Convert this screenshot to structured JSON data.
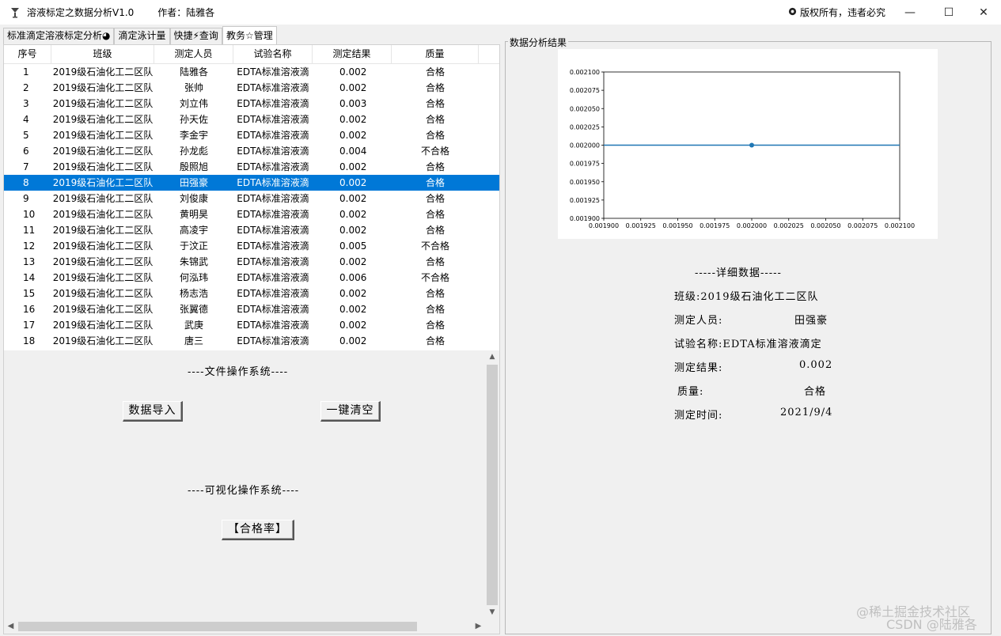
{
  "window": {
    "title": "溶液标定之数据分析V1.0",
    "author": "作者：陆雅各",
    "copyright": "版权所有，违者必究",
    "minimize": "—",
    "maximize": "☐",
    "close": "✕"
  },
  "tabs": [
    {
      "label": "标准滴定溶液标定分析◕"
    },
    {
      "label": "滴定泳计量"
    },
    {
      "label": "快捷⚡查询"
    },
    {
      "label": "教务☆管理"
    }
  ],
  "table": {
    "headers": [
      "序号",
      "班级",
      "测定人员",
      "试验名称",
      "测定结果",
      "质量"
    ],
    "rows": [
      [
        "1",
        "2019级石油化工二区队",
        "陆雅各",
        "EDTA标准溶液滴",
        "0.002",
        "合格"
      ],
      [
        "2",
        "2019级石油化工二区队",
        "张帅",
        "EDTA标准溶液滴",
        "0.002",
        "合格"
      ],
      [
        "3",
        "2019级石油化工二区队",
        "刘立伟",
        "EDTA标准溶液滴",
        "0.003",
        "合格"
      ],
      [
        "4",
        "2019级石油化工二区队",
        "孙天佐",
        "EDTA标准溶液滴",
        "0.002",
        "合格"
      ],
      [
        "5",
        "2019级石油化工二区队",
        "李金宇",
        "EDTA标准溶液滴",
        "0.002",
        "合格"
      ],
      [
        "6",
        "2019级石油化工二区队",
        "孙龙彪",
        "EDTA标准溶液滴",
        "0.004",
        "不合格"
      ],
      [
        "7",
        "2019级石油化工二区队",
        "殷照旭",
        "EDTA标准溶液滴",
        "0.002",
        "合格"
      ],
      [
        "8",
        "2019级石油化工二区队",
        "田强豪",
        "EDTA标准溶液滴",
        "0.002",
        "合格"
      ],
      [
        "9",
        "2019级石油化工二区队",
        "刘俊康",
        "EDTA标准溶液滴",
        "0.002",
        "合格"
      ],
      [
        "10",
        "2019级石油化工二区队",
        "黄明昊",
        "EDTA标准溶液滴",
        "0.002",
        "合格"
      ],
      [
        "11",
        "2019级石油化工二区队",
        "高凌宇",
        "EDTA标准溶液滴",
        "0.002",
        "合格"
      ],
      [
        "12",
        "2019级石油化工二区队",
        "于汶正",
        "EDTA标准溶液滴",
        "0.005",
        "不合格"
      ],
      [
        "13",
        "2019级石油化工二区队",
        "朱锦武",
        "EDTA标准溶液滴",
        "0.002",
        "合格"
      ],
      [
        "14",
        "2019级石油化工二区队",
        "何泓玮",
        "EDTA标准溶液滴",
        "0.006",
        "不合格"
      ],
      [
        "15",
        "2019级石油化工二区队",
        "杨志浩",
        "EDTA标准溶液滴",
        "0.002",
        "合格"
      ],
      [
        "16",
        "2019级石油化工二区队",
        "张翼德",
        "EDTA标准溶液滴",
        "0.002",
        "合格"
      ],
      [
        "17",
        "2019级石油化工二区队",
        "武庚",
        "EDTA标准溶液滴",
        "0.002",
        "合格"
      ],
      [
        "18",
        "2019级石油化工二区队",
        "唐三",
        "EDTA标准溶液滴",
        "0.002",
        "合格"
      ]
    ],
    "selected_row": 8
  },
  "ops": {
    "file_section": "----文件操作系统----",
    "import_button": "数据导入",
    "clear_button": "一键清空",
    "viz_section": "----可视化操作系统----",
    "pass_rate_button": "【合格率】"
  },
  "analysis": {
    "group_label": "数据分析结果",
    "detail_title": "-----详细数据-----",
    "class_label": "班级:2019级石油化工二区队",
    "person_label": "测定人员:",
    "person_value": "田强豪",
    "test_label": "试验名称:EDTA标准溶液滴定",
    "result_label": "测定结果:",
    "result_value": "0.002",
    "quality_label": "质量:",
    "quality_value": "合格",
    "time_label": "测定时间:",
    "time_value": "2021/9/4"
  },
  "chart_data": {
    "type": "line",
    "x": [
      0.002
    ],
    "y": [
      0.002
    ],
    "xlim": [
      0.0019,
      0.0021
    ],
    "ylim": [
      0.0019,
      0.0021
    ],
    "xticks": [
      "0.001900",
      "0.001925",
      "0.001950",
      "0.001975",
      "0.002000",
      "0.002025",
      "0.002050",
      "0.002075",
      "0.002100"
    ],
    "yticks": [
      "0.001900",
      "0.001925",
      "0.001950",
      "0.001975",
      "0.002000",
      "0.002025",
      "0.002050",
      "0.002075",
      "0.002100"
    ],
    "color": "#1f77b4",
    "grid": false
  },
  "watermark": {
    "line1": "@稀土掘金技术社区",
    "line2": "CSDN @陆雅各"
  }
}
